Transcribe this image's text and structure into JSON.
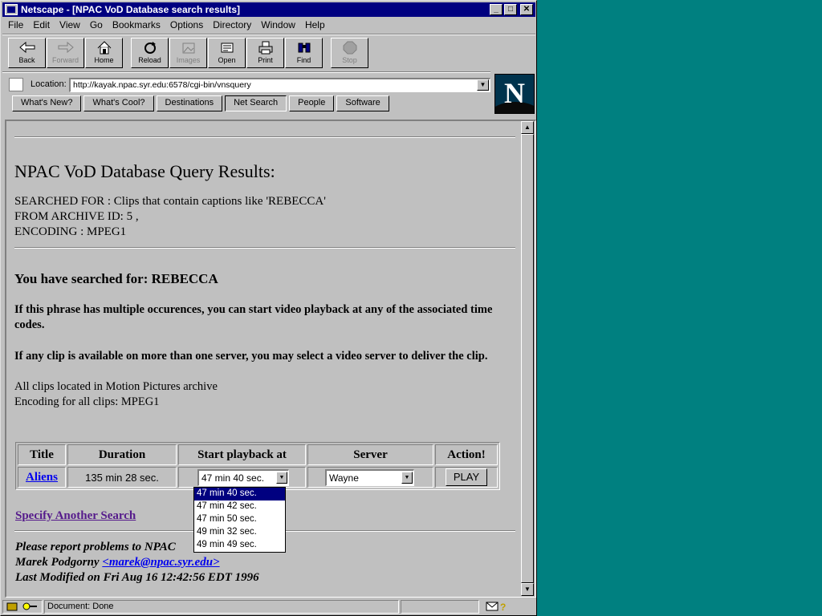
{
  "window": {
    "title": "Netscape - [NPAC VoD Database search results]",
    "controls": {
      "minimize": "_",
      "maximize": "□",
      "close": "✕"
    }
  },
  "menu": [
    "File",
    "Edit",
    "View",
    "Go",
    "Bookmarks",
    "Options",
    "Directory",
    "Window",
    "Help"
  ],
  "toolbar": {
    "back": "Back",
    "forward": "Forward",
    "home": "Home",
    "reload": "Reload",
    "images": "Images",
    "open": "Open",
    "print": "Print",
    "find": "Find",
    "stop": "Stop"
  },
  "location": {
    "label": "Location:",
    "url": "http://kayak.npac.syr.edu:6578/cgi-bin/vnsquery"
  },
  "directory_buttons": [
    "What's New?",
    "What's Cool?",
    "Destinations",
    "Net Search",
    "People",
    "Software"
  ],
  "logo": "N",
  "page": {
    "heading": "NPAC VoD Database Query Results:",
    "searched_for": "SEARCHED FOR : Clips that contain captions like 'REBECCA'",
    "archive_id": "FROM ARCHIVE ID: 5 ,",
    "encoding": "ENCODING : MPEG1",
    "subheading": "You have searched for: REBECCA",
    "para1": "If this phrase has multiple occurences, you can start video playback at any of the associated time codes.",
    "para2": "If any clip is available on more than one server, you may select a video server to deliver the clip.",
    "para3_line1": "All clips located in Motion Pictures archive",
    "para3_line2": "Encoding for all clips: MPEG1",
    "table": {
      "headers": [
        "Title",
        "Duration",
        "Start playback at",
        "Server",
        "Action!"
      ],
      "row": {
        "title": "Aliens",
        "duration": "135 min 28 sec.",
        "start": "47 min 40 sec.",
        "server": "Wayne",
        "action": "PLAY"
      }
    },
    "start_options": [
      "47 min 40 sec.",
      "47 min 42 sec.",
      "47 min 50 sec.",
      "49 min 32 sec.",
      "49 min 49 sec."
    ],
    "another_search": "Specify Another Search",
    "footer_line1": "Please report problems to NPAC",
    "footer_name": "Marek Podgorny",
    "footer_email": "<marek@npac.syr.edu>",
    "footer_modified": "Last Modified on Fri Aug 16 12:42:56 EDT 1996"
  },
  "status": {
    "text": "Document: Done"
  }
}
